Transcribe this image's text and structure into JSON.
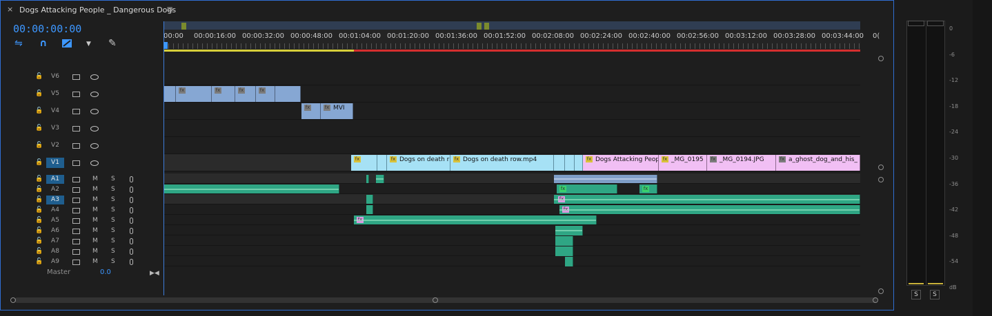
{
  "window": {
    "tab_title": "Dogs Attacking People _ Dangerous Dogs",
    "close_glyph": "×",
    "menu_glyph": "≡"
  },
  "timecode": "00:00:00:00",
  "toolbar": [
    {
      "name": "snap-in-sequence-icon",
      "glyph": "⇋"
    },
    {
      "name": "linked-selection-icon",
      "glyph": "∩"
    },
    {
      "name": "add-marker-icon",
      "glyph": "▼"
    },
    {
      "name": "timeline-settings-icon",
      "glyph": "✎"
    }
  ],
  "ruler": {
    "labels": [
      "00:00",
      "00:00:16:00",
      "00:00:32:00",
      "00:00:48:00",
      "00:01:04:00",
      "00:01:20:00",
      "00:01:36:00",
      "00:01:52:00",
      "00:02:08:00",
      "00:02:24:00",
      "00:02:40:00",
      "00:02:56:00",
      "00:03:12:00",
      "00:03:28:00",
      "00:03:44:00",
      "0("
    ],
    "workbar_yellow_end_sec": 64
  },
  "video_tracks": [
    {
      "name": "V6"
    },
    {
      "name": "V5"
    },
    {
      "name": "V4"
    },
    {
      "name": "V3"
    },
    {
      "name": "V2"
    },
    {
      "name": "V1",
      "active": true
    }
  ],
  "audio_tracks": [
    {
      "name": "A1",
      "active": true
    },
    {
      "name": "A2"
    },
    {
      "name": "A3",
      "active": true
    },
    {
      "name": "A4"
    },
    {
      "name": "A5"
    },
    {
      "name": "A6"
    },
    {
      "name": "A7"
    },
    {
      "name": "A8"
    },
    {
      "name": "A9"
    }
  ],
  "audio_buttons": {
    "mute": "M",
    "solo": "S"
  },
  "master": {
    "label": "Master",
    "value": "0.0"
  },
  "clips": {
    "v4_mvi": "MVI",
    "v1_death_row_1": "Dogs on death r",
    "v1_death_row_2": "Dogs on death row.mp4",
    "v1_attacking": "Dogs Attacking Peop",
    "v1_mg0195": "_MG_0195",
    "v1_mg0194": "_MG_0194.JPG",
    "v1_ghost": "a_ghost_dog_and_his_"
  },
  "fx_label": "fx",
  "meter": {
    "db_labels": [
      "0",
      "-6",
      "-12",
      "-18",
      "-24",
      "-30",
      "-36",
      "-42",
      "-48",
      "-54",
      "dB"
    ],
    "solo_labels": [
      "S",
      "S"
    ]
  }
}
